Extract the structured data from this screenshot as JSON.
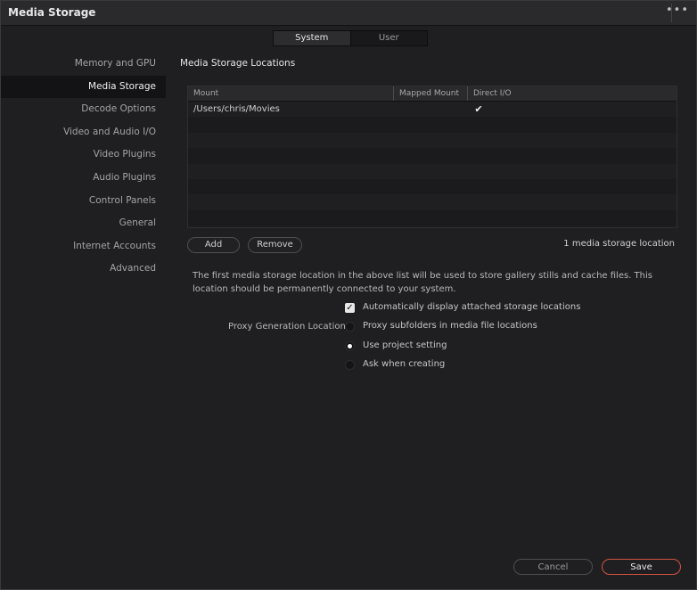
{
  "window": {
    "title": "Media Storage"
  },
  "tabs": [
    {
      "label": "System",
      "active": true
    },
    {
      "label": "User",
      "active": false
    }
  ],
  "sidebar": {
    "items": [
      {
        "label": "Memory and GPU"
      },
      {
        "label": "Media Storage",
        "active": true
      },
      {
        "label": "Decode Options"
      },
      {
        "label": "Video and Audio I/O"
      },
      {
        "label": "Video Plugins"
      },
      {
        "label": "Audio Plugins"
      },
      {
        "label": "Control Panels"
      },
      {
        "label": "General"
      },
      {
        "label": "Internet Accounts"
      },
      {
        "label": "Advanced"
      }
    ]
  },
  "storage": {
    "section_title": "Media Storage Locations",
    "columns": [
      "Mount",
      "Mapped Mount",
      "Direct I/O"
    ],
    "rows": [
      {
        "mount": "/Users/chris/Movies",
        "mapped": "",
        "direct_io": true
      }
    ],
    "add_label": "Add",
    "remove_label": "Remove",
    "count_text": "1 media storage location"
  },
  "info_text": "The first media storage location in the above list will be used to store gallery stills and cache files. This location should be permanently connected to your system.",
  "options": {
    "auto_display_label": "Automatically display attached storage locations",
    "auto_display_checked": true,
    "proxy_label": "Proxy Generation Location",
    "proxy_options": [
      {
        "label": "Proxy subfolders in media file locations",
        "selected": false
      },
      {
        "label": "Use project setting",
        "selected": true
      },
      {
        "label": "Ask when creating",
        "selected": false
      }
    ]
  },
  "footer": {
    "cancel_label": "Cancel",
    "save_label": "Save"
  },
  "colors": {
    "accent": "#d2533f",
    "background": "#1f1f22"
  }
}
